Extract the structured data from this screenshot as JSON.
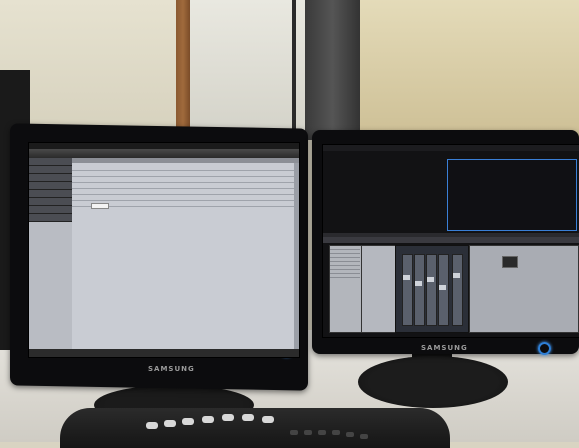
{
  "scene": {
    "left_monitor": {
      "brand": "SAMSUNG"
    },
    "right_monitor": {
      "brand": "SAMSUNG"
    }
  },
  "colors": {
    "power_led": "#2e7fd6",
    "video_frame_border": "#3a7fd6",
    "door_frame": "#a06a3c"
  }
}
